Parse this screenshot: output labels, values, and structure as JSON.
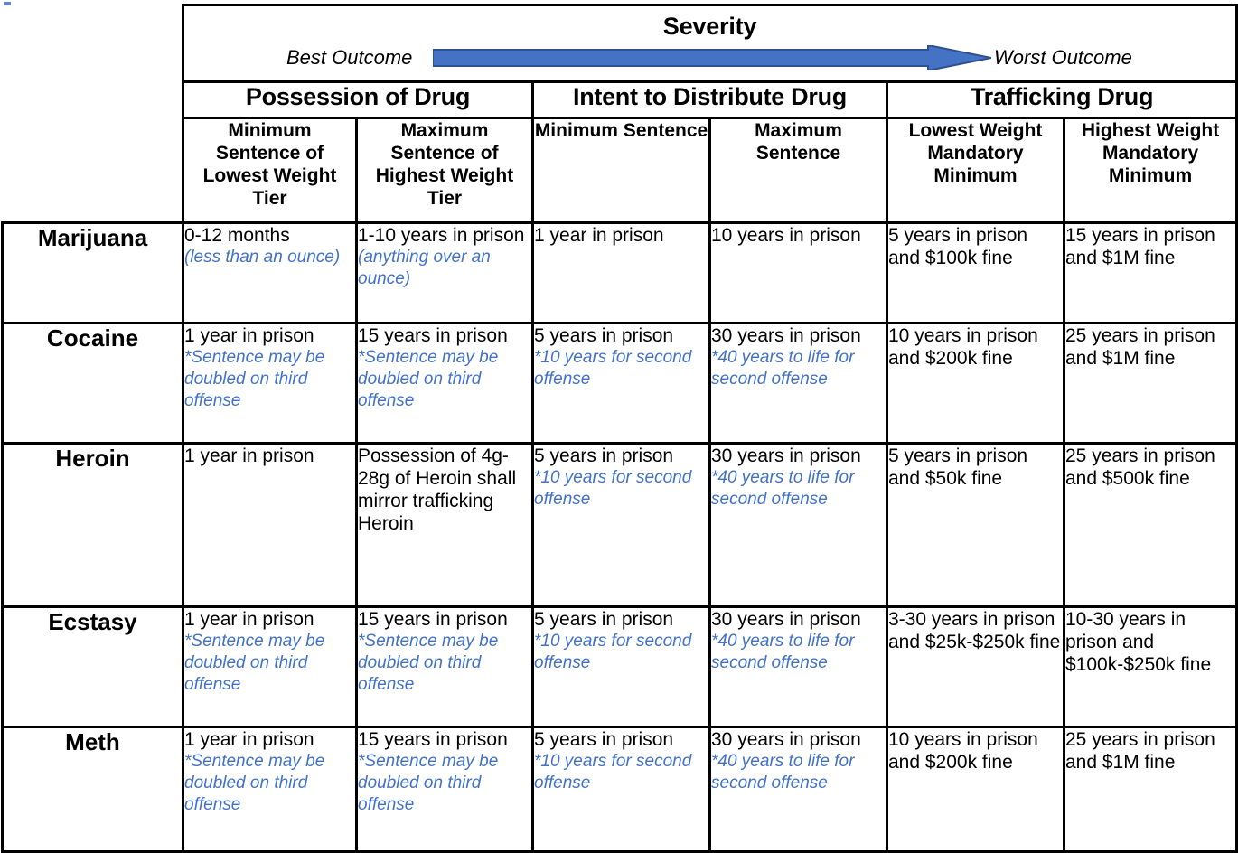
{
  "severity": {
    "title": "Severity",
    "best_label": "Best Outcome",
    "worst_label": "Worst Outcome",
    "arrow_color": "#4472c4",
    "arrow_outline": "#2f528f",
    "direction": "left-to-right"
  },
  "groups": [
    {
      "label": "Possession of Drug"
    },
    {
      "label": "Intent to Distribute Drug"
    },
    {
      "label": "Trafficking Drug"
    }
  ],
  "columns": [
    {
      "label": "Minimum Sentence of Lowest Weight Tier"
    },
    {
      "label": "Maximum Sentence of Highest Weight Tier"
    },
    {
      "label": "Minimum Sentence"
    },
    {
      "label": "Maximum Sentence"
    },
    {
      "label": "Lowest Weight Mandatory Minimum"
    },
    {
      "label": "Highest Weight Mandatory Minimum"
    }
  ],
  "note_color": "#4272c8",
  "rows": [
    {
      "drug": "Marijuana",
      "cells": [
        {
          "main": "0-12 months",
          "note": "(less than an ounce)"
        },
        {
          "main": "1-10 years in prison",
          "note": "(anything over an ounce)"
        },
        {
          "main": "1 year in prison",
          "note": ""
        },
        {
          "main": "10 years in prison",
          "note": ""
        },
        {
          "main": "5 years in prison and $100k fine",
          "note": ""
        },
        {
          "main": "15 years in prison and $1M fine",
          "note": ""
        }
      ]
    },
    {
      "drug": "Cocaine",
      "cells": [
        {
          "main": "1 year in prison",
          "note": "*Sentence may be doubled on third offense"
        },
        {
          "main": "15 years in prison",
          "note": "*Sentence may be doubled on third offense"
        },
        {
          "main": "5 years in prison",
          "note": "*10 years for second offense"
        },
        {
          "main": "30 years in prison",
          "note": "*40 years to life for second offense"
        },
        {
          "main": "10 years in prison and $200k fine",
          "note": ""
        },
        {
          "main": "25 years in prison and $1M fine",
          "note": ""
        }
      ]
    },
    {
      "drug": "Heroin",
      "cells": [
        {
          "main": "1 year in prison",
          "note": ""
        },
        {
          "main": "Possession of 4g-28g of Heroin shall mirror trafficking Heroin",
          "note": ""
        },
        {
          "main": "5 years in prison",
          "note": "*10 years for second offense"
        },
        {
          "main": "30 years in prison",
          "note": "*40 years to life for second offense"
        },
        {
          "main": "5 years in prison and $50k fine",
          "note": ""
        },
        {
          "main": "25 years in prison and $500k fine",
          "note": ""
        }
      ]
    },
    {
      "drug": "Ecstasy",
      "cells": [
        {
          "main": "1 year in prison",
          "note": "*Sentence may be doubled on third offense"
        },
        {
          "main": "15 years in prison",
          "note": "*Sentence may be doubled on third offense"
        },
        {
          "main": "5 years in prison",
          "note": "*10 years for second offense"
        },
        {
          "main": "30 years in prison",
          "note": "*40 years to life for second offense"
        },
        {
          "main": "3-30 years in prison and $25k-$250k fine",
          "note": ""
        },
        {
          "main": "10-30 years in prison and $100k-$250k fine",
          "note": ""
        }
      ]
    },
    {
      "drug": "Meth",
      "cells": [
        {
          "main": "1 year in prison",
          "note": "*Sentence may be doubled on third offense"
        },
        {
          "main": "15 years in prison",
          "note": "*Sentence may be doubled on third offense"
        },
        {
          "main": "5 years in prison",
          "note": "*10 years for second offense"
        },
        {
          "main": "30 years in prison",
          "note": "*40 years to life for second offense"
        },
        {
          "main": "10 years in prison and $200k fine",
          "note": ""
        },
        {
          "main": "25 years in prison and $1M fine",
          "note": ""
        }
      ]
    }
  ]
}
